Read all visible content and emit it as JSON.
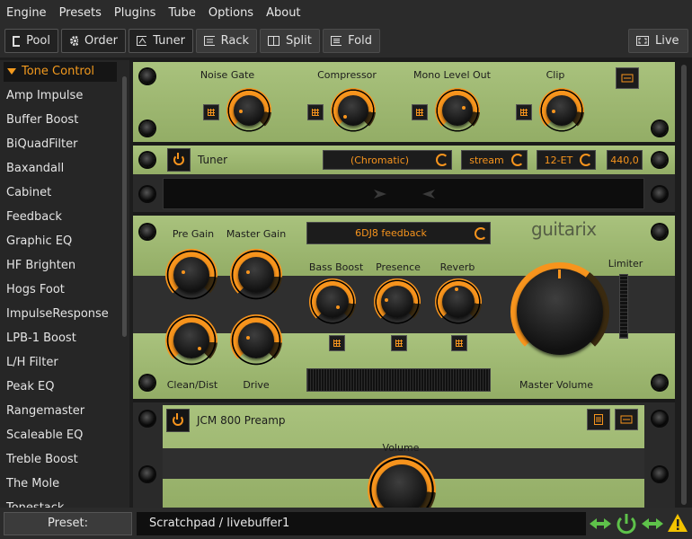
{
  "menu": [
    "Engine",
    "Presets",
    "Plugins",
    "Tube",
    "Options",
    "About"
  ],
  "toolbar": {
    "pool": "Pool",
    "order": "Order",
    "tuner": "Tuner",
    "rack": "Rack",
    "split": "Split",
    "fold": "Fold",
    "live": "Live"
  },
  "sidebar": {
    "header": "Tone Control",
    "items": [
      "Amp Impulse",
      "Buffer Boost",
      "BiQuadFilter",
      "Baxandall",
      "Cabinet",
      "Feedback",
      "Graphic EQ",
      "HF Brighten",
      "Hogs Foot",
      "ImpulseResponse",
      "LPB-1 Boost",
      "L/H Filter",
      "Peak EQ",
      "Rangemaster",
      "Scaleable EQ",
      "Treble Boost",
      "The Mole",
      "Tonestack"
    ]
  },
  "mono_strip": {
    "labels": [
      "Noise Gate",
      "Compressor",
      "Mono Level Out",
      "Clip"
    ]
  },
  "tuner": {
    "title": "Tuner",
    "mode": "(Chromatic)",
    "source": "stream",
    "temperament": "12-ET",
    "reference": "440,0"
  },
  "amp": {
    "pre_gain": "Pre Gain",
    "master_gain": "Master Gain",
    "tube": "6DJ8 feedback",
    "logo": "guitarix",
    "bass_boost": "Bass Boost",
    "presence": "Presence",
    "reverb": "Reverb",
    "limiter": "Limiter",
    "clean_dist": "Clean/Dist",
    "drive": "Drive",
    "master_volume": "Master Volume"
  },
  "preamp": {
    "title": "JCM 800 Preamp",
    "volume": "Volume"
  },
  "status": {
    "preset_label": "Preset:",
    "preset_name": "Scratchpad / livebuffer1"
  },
  "colors": {
    "accent": "#f7941d",
    "panel_green": "#a3bc75",
    "background": "#1d1d1d"
  }
}
